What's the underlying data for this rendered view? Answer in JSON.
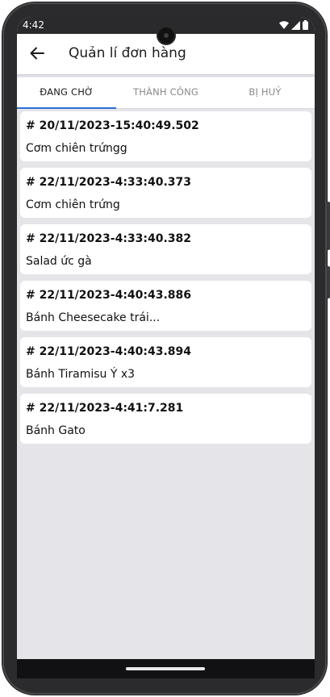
{
  "status_bar": {
    "time": "4:42",
    "icons": [
      "wifi-icon",
      "signal-icon",
      "battery-icon"
    ]
  },
  "app_bar": {
    "title": "Quản lí đơn hàng",
    "back_icon": "arrow-left-icon"
  },
  "tabs": [
    {
      "label": "ĐANG CHỜ",
      "active": true
    },
    {
      "label": "THÀNH CÔNG",
      "active": false
    },
    {
      "label": "BỊ HUỶ",
      "active": false
    }
  ],
  "orders": [
    {
      "id": "# 20/11/2023-15:40:49.502",
      "name": "Cơm chiên trứngg"
    },
    {
      "id": "# 22/11/2023-4:33:40.373",
      "name": "Cơm chiên trứng"
    },
    {
      "id": "# 22/11/2023-4:33:40.382",
      "name": "Salad ức gà"
    },
    {
      "id": "# 22/11/2023-4:40:43.886",
      "name": "Bánh Cheesecake trái..."
    },
    {
      "id": "# 22/11/2023-4:40:43.894",
      "name": "Bánh Tiramisu Ý x3"
    },
    {
      "id": "# 22/11/2023-4:41:7.281",
      "name": "Bánh Gato"
    }
  ],
  "colors": {
    "accent": "#2d6fd6",
    "background": "#e5e5e9",
    "card": "#ffffff"
  }
}
